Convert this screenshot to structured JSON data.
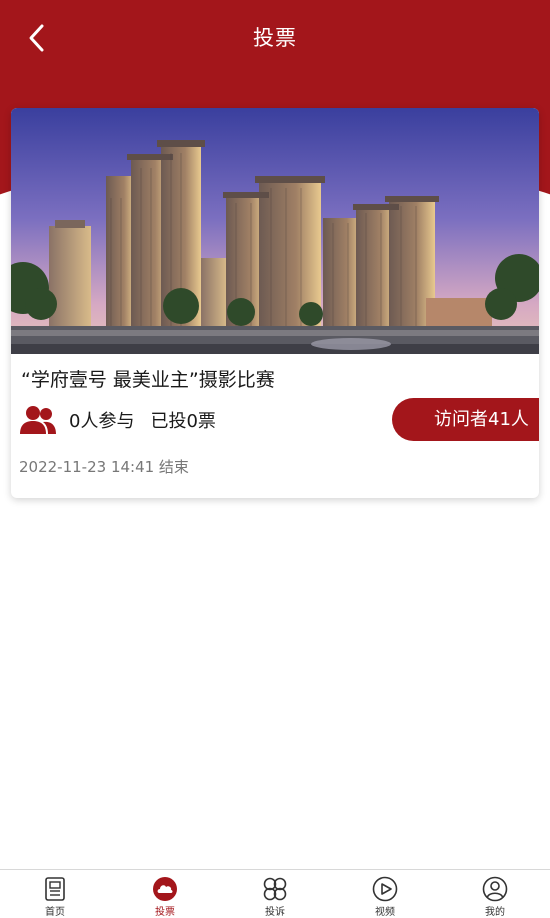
{
  "header": {
    "title": "投票",
    "bg_color": "#a3161b"
  },
  "card": {
    "title": "“学府壹号 最美业主”摄影比赛",
    "participants": "0人参与",
    "votes": "已投0票",
    "visitors": "访问者41人",
    "end_time": "2022-11-23 14:41 结束"
  },
  "tabbar": {
    "items": [
      {
        "label": "首页",
        "icon": "newspaper-icon",
        "active": false
      },
      {
        "label": "投票",
        "icon": "vote-icon",
        "active": true
      },
      {
        "label": "投诉",
        "icon": "clover-icon",
        "active": false
      },
      {
        "label": "视频",
        "icon": "play-icon",
        "active": false
      },
      {
        "label": "我的",
        "icon": "user-icon",
        "active": false
      }
    ]
  }
}
